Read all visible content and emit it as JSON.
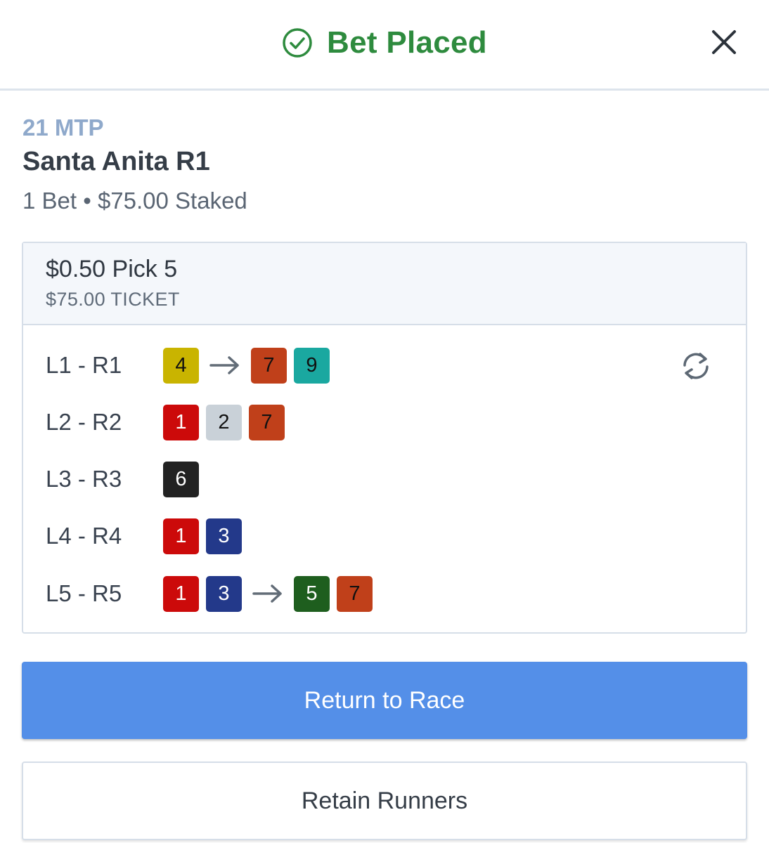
{
  "header": {
    "title": "Bet Placed",
    "status_icon": "check-circle-icon",
    "close_icon": "close-icon",
    "accent_color": "#2e8b3e"
  },
  "race": {
    "mtp": "21 MTP",
    "name": "Santa Anita R1",
    "summary": "1 Bet • $75.00 Staked"
  },
  "bet": {
    "type": "$0.50 Pick 5",
    "ticket": "$75.00 TICKET",
    "swap_icon": "refresh-swap-icon",
    "legs": [
      {
        "label": "L1 - R1",
        "before": [
          {
            "num": "4",
            "bg": "#c9b400",
            "fg": "#111111"
          }
        ],
        "after": [
          {
            "num": "7",
            "bg": "#c0401a",
            "fg": "#111111"
          },
          {
            "num": "9",
            "bg": "#1aa8a0",
            "fg": "#111111"
          }
        ]
      },
      {
        "label": "L2 - R2",
        "before": [
          {
            "num": "1",
            "bg": "#cc0a0a",
            "fg": "#ffffff"
          },
          {
            "num": "2",
            "bg": "#c9d1d8",
            "fg": "#111111"
          },
          {
            "num": "7",
            "bg": "#c0401a",
            "fg": "#111111"
          }
        ],
        "after": []
      },
      {
        "label": "L3 - R3",
        "before": [
          {
            "num": "6",
            "bg": "#222222",
            "fg": "#ffffff"
          }
        ],
        "after": []
      },
      {
        "label": "L4 - R4",
        "before": [
          {
            "num": "1",
            "bg": "#cc0a0a",
            "fg": "#ffffff"
          },
          {
            "num": "3",
            "bg": "#23398a",
            "fg": "#ffffff"
          }
        ],
        "after": []
      },
      {
        "label": "L5 - R5",
        "before": [
          {
            "num": "1",
            "bg": "#cc0a0a",
            "fg": "#ffffff"
          },
          {
            "num": "3",
            "bg": "#23398a",
            "fg": "#ffffff"
          }
        ],
        "after": [
          {
            "num": "5",
            "bg": "#1e5e1e",
            "fg": "#ffffff"
          },
          {
            "num": "7",
            "bg": "#c0401a",
            "fg": "#111111"
          }
        ]
      }
    ]
  },
  "actions": {
    "primary_label": "Return to Race",
    "primary_color": "#548fe8",
    "secondary_label": "Retain Runners"
  }
}
